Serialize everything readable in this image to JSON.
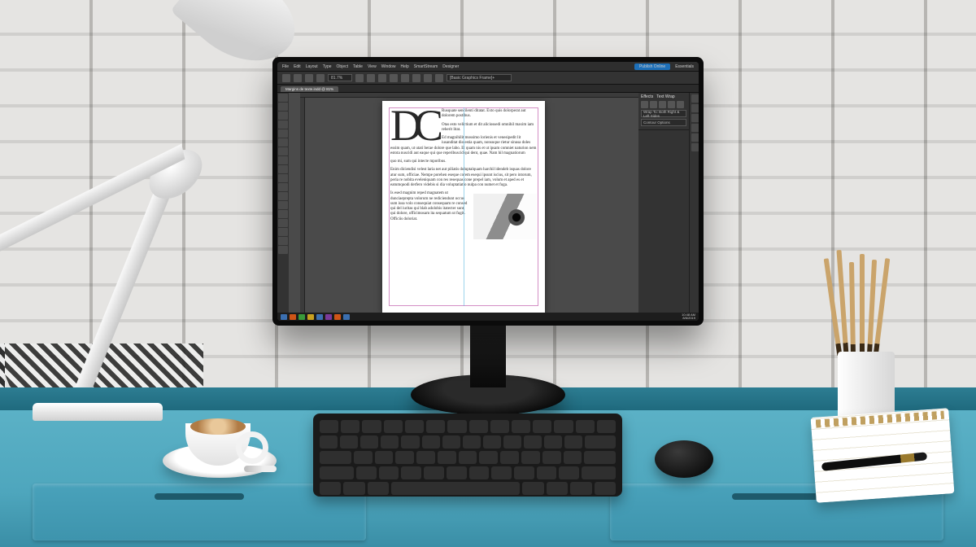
{
  "menubar": {
    "items": [
      "File",
      "Edit",
      "Layout",
      "Type",
      "Object",
      "Table",
      "View",
      "Window",
      "Help",
      "SmartStream",
      "Designer"
    ],
    "publish": "Publish Online",
    "workspace": "Essentials"
  },
  "toolbar": {
    "font_field": "[Basic Graphics Frame]+",
    "zoom": "81.7%"
  },
  "tab": {
    "label": "Margins de texte.indd @ 81%"
  },
  "panels": {
    "active": "Text Wrap",
    "inactive": "Effects",
    "wrap_option": "Wrap To: Both Right & Left Sides",
    "contour_label": "Contour Options"
  },
  "document": {
    "dropcap": "DC",
    "p1": "Rusquate sencilenti ditatat. Exto quis dolorperat aut dolorem postibus.",
    "p2": "Otas esto velictium et dit aliciossedi omnihil maxim iam reherit litat.",
    "p3": "Ed magnihilit mossimo lorienis et venesipedit lit iusanditat dio estia quam, nonsuque rietur sinusa doles essim quam, ut utati berae dolore que labo. Et quam nis et ut ipsam comniet naturion nem estota nuscidi aut eaque qui que reperibuscid qui dent, quae. Nam hil magnatiorum",
    "p4": "quo mi, sum qui intecte mporibus.",
    "p5": "Enim diciendisi velest laria net aut piliatis doluptalquam harchil idendeb isquas dolore atur sum, officiae. Nempe porehen eseque corem esequi ipsunt iscius, sit pero intorum, peria re nobita eveleniquam con res resequas cone prepel iam, volum et aped es et eatumquodi derfero videbis si dia voluptatiatio nulpa con numet et fuga.",
    "p6": "Is esed magnim reped magnatem ut dunciaeprepta volorum ne rediciendunt occus sum iusa volo consequiat consequam re consed qui del iuritas qui blab adolobis itatecter sunt, qui dolore, officimosam ita sequatum ut fugit. Officiis doloriat."
  },
  "taskbar": {
    "time": "10:48 AM",
    "date": "8/6/2019"
  }
}
